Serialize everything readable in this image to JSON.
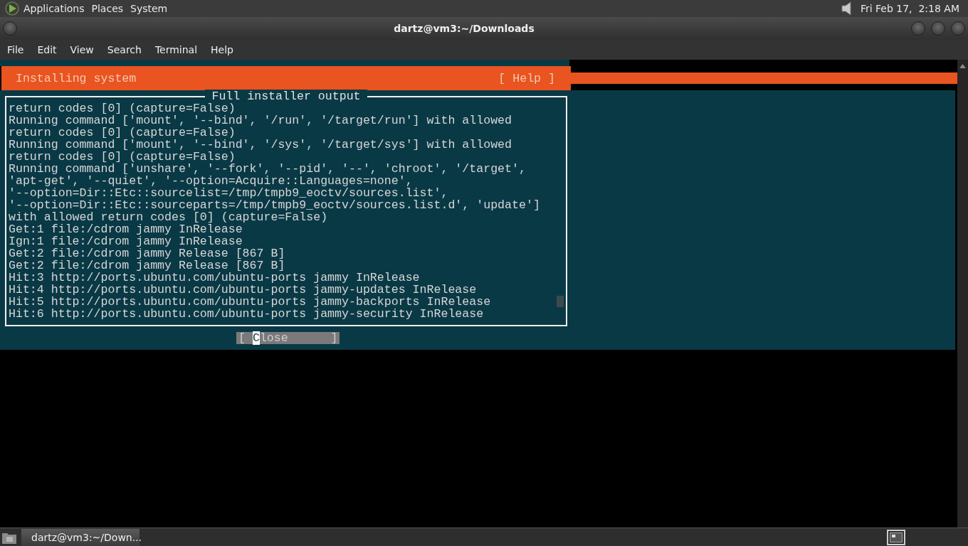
{
  "top_panel": {
    "menus": [
      "Applications",
      "Places",
      "System"
    ],
    "clock": "Fri Feb 17,  2:18 AM"
  },
  "window": {
    "title": "dartz@vm3:~/Downloads",
    "menu": [
      "File",
      "Edit",
      "View",
      "Search",
      "Terminal",
      "Help"
    ]
  },
  "installer": {
    "header": "Installing system",
    "help": "[ Help ]",
    "dialog_title": "Full installer output",
    "lines": [
      "return codes [0] (capture=False)",
      "Running command ['mount', '--bind', '/run', '/target/run'] with allowed",
      "return codes [0] (capture=False)",
      "Running command ['mount', '--bind', '/sys', '/target/sys'] with allowed",
      "return codes [0] (capture=False)",
      "Running command ['unshare', '--fork', '--pid', '--', 'chroot', '/target',",
      "'apt-get', '--quiet', '--option=Acquire::Languages=none',",
      "'--option=Dir::Etc::sourcelist=/tmp/tmpb9_eoctv/sources.list',",
      "'--option=Dir::Etc::sourceparts=/tmp/tmpb9_eoctv/sources.list.d', 'update']",
      "with allowed return codes [0] (capture=False)",
      "Get:1 file:/cdrom jammy InRelease",
      "Ign:1 file:/cdrom jammy InRelease",
      "Get:2 file:/cdrom jammy Release [867 B]",
      "Get:2 file:/cdrom jammy Release [867 B]",
      "Hit:3 http://ports.ubuntu.com/ubuntu-ports jammy InRelease",
      "Hit:4 http://ports.ubuntu.com/ubuntu-ports jammy-updates InRelease",
      "Hit:5 http://ports.ubuntu.com/ubuntu-ports jammy-backports InRelease",
      "Hit:6 http://ports.ubuntu.com/ubuntu-ports jammy-security InRelease"
    ],
    "close_button": "[ Close      ]"
  },
  "taskbar": {
    "tasks": [
      {
        "label": "dartz@vm3:~/Down...",
        "selected": true
      }
    ]
  }
}
